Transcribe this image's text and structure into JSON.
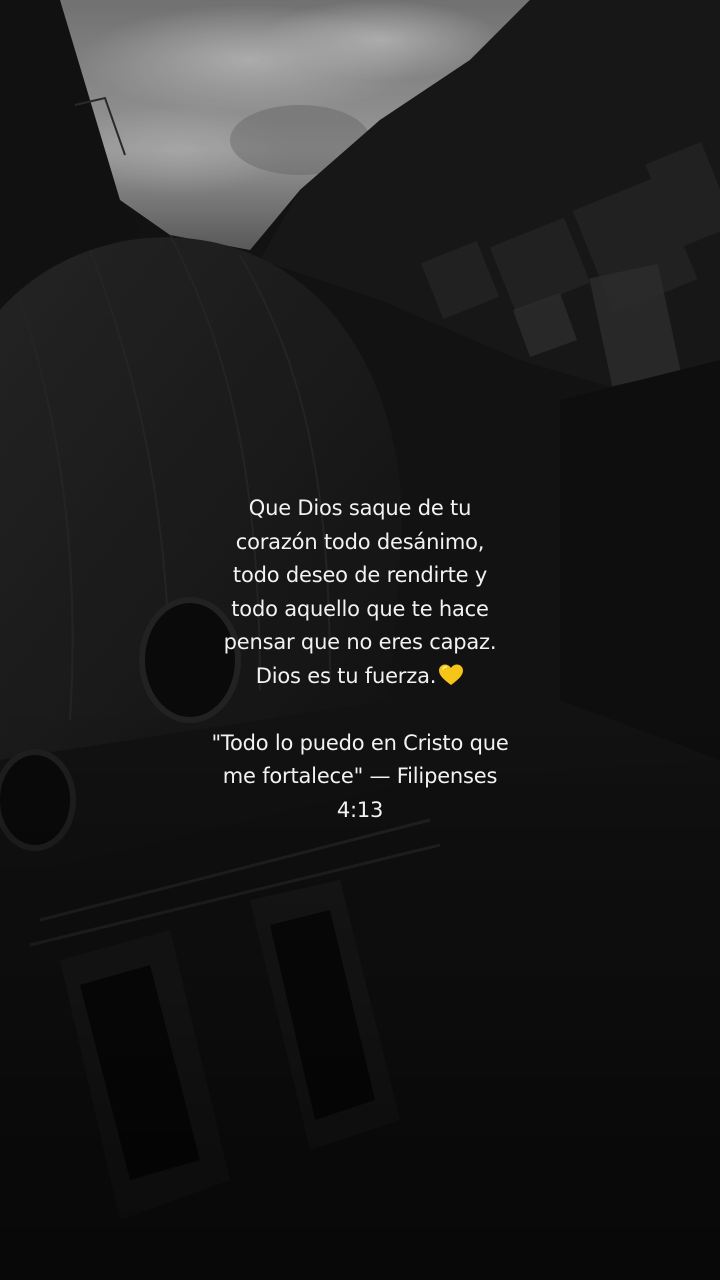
{
  "quote": {
    "lines": [
      "Que Dios saque de tu",
      "corazón todo desánimo,",
      "todo deseo de rendirte y",
      "todo aquello que te hace",
      "pensar que no eres capaz."
    ],
    "closing_line": "Dios es tu fuerza.",
    "closing_icon": "yellow-heart-icon",
    "heart_color": "#F5C518"
  },
  "verse": {
    "lines": [
      "\"Todo lo puedo en Cristo que",
      "me fortalece\" — Filipenses",
      "4:13"
    ]
  },
  "background": {
    "description_icon": "monochrome-cathedral-dome-photo"
  }
}
